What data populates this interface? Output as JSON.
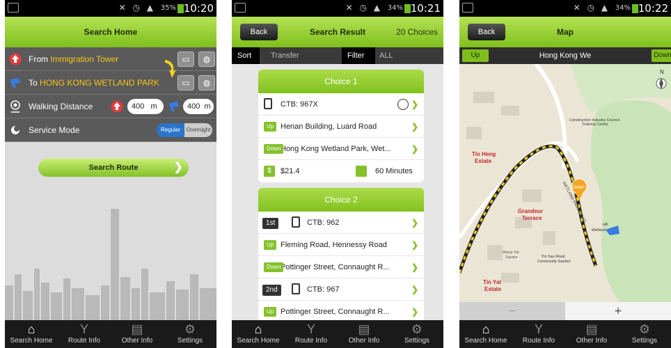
{
  "status": [
    {
      "battery": "35%",
      "time": "10:20"
    },
    {
      "battery": "34%",
      "time": "10:21"
    },
    {
      "battery": "34%",
      "time": "10:22"
    }
  ],
  "nav": {
    "items": [
      "Search Home",
      "Route Info",
      "Other Info",
      "Settings"
    ]
  },
  "search_home": {
    "title": "Search Home",
    "from_label": "From",
    "from_value": "Immigration Tower",
    "to_label": "To",
    "to_value": "HONG KONG WETLAND PARK",
    "walking_label": "Walking Distance",
    "walk_from": "400",
    "walk_to": "400",
    "walk_unit": "m",
    "service_label": "Service Mode",
    "mode_regular": "Regular",
    "mode_overnight": "Overnight",
    "search_button": "Search Route"
  },
  "search_result": {
    "back": "Back",
    "title": "Search Result",
    "count": "20 Choices",
    "sort_label": "Sort",
    "sort_value": "Transfer",
    "filter_label": "Filter",
    "filter_value": "ALL",
    "choice1": {
      "title": "Choice 1",
      "route": "CTB: 967X",
      "up_tag": "Up",
      "up_stop": "Henan Building, Luard Road",
      "down_tag": "Down",
      "down_stop": "Hong Kong Wetland Park, Wet...",
      "fare_icon": "$",
      "fare": "$21.4",
      "duration": "60 Minutes"
    },
    "choice2": {
      "title": "Choice 2",
      "leg1": "1st",
      "route1": "CTB: 962",
      "up_tag": "Up",
      "up_stop": "Fleming Road, Hennessy Road",
      "down_tag": "Down",
      "down_stop": "Pottinger Street, Connaught R...",
      "leg2": "2nd",
      "route2": "CTB: 967",
      "up2_tag": "Up",
      "up2_stop": "Pottinger Street, Connaught R..."
    }
  },
  "map_screen": {
    "back": "Back",
    "title": "Map",
    "up": "Up",
    "down": "Down",
    "location": "Hong Kong We",
    "compass": "N",
    "labels": {
      "cic": "Construction Industry Council",
      "cic2": "Training Centre",
      "tinheng": "Tin Heng",
      "tinheng2": "Estate",
      "grandeur": "Grandeur",
      "grandeur2": "Terrace",
      "hkw": "HK",
      "hkw2": "Wetland",
      "wangyat": "Wang Yat",
      "wangyat2": "Square",
      "tinsau": "Tin Sau Road",
      "tinsau2": "Community Garden",
      "tinyat": "Tin Yat",
      "tinyat2": "Estate",
      "road": "WETLAND PARK ROAD",
      "pin": "Down"
    },
    "zoom_out": "−",
    "zoom_in": "+"
  },
  "colors": {
    "accent": "#84c12a",
    "hl": "#f5c518",
    "blue": "#2b74c9"
  }
}
